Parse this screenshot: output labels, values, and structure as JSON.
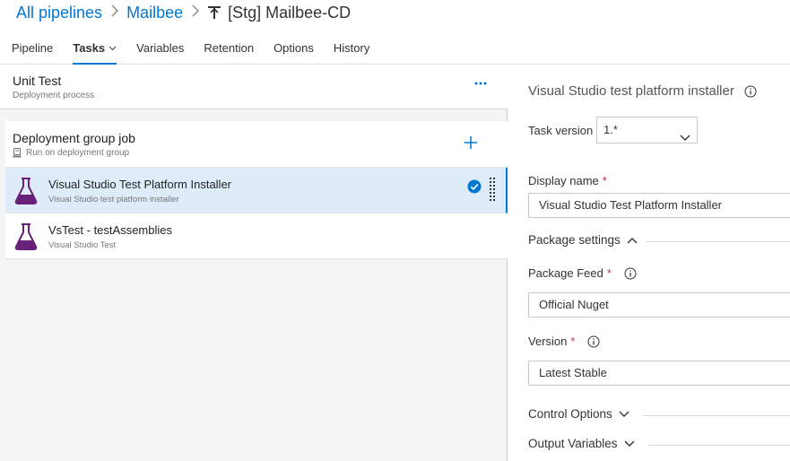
{
  "breadcrumb": {
    "all_pipelines": "All pipelines",
    "folder": "Mailbee",
    "pipeline_name": "[Stg] Mailbee-CD",
    "pipeline_icon": "release-pipeline-icon"
  },
  "tabs": [
    {
      "label": "Pipeline"
    },
    {
      "label": "Tasks",
      "active": true
    },
    {
      "label": "Variables"
    },
    {
      "label": "Retention"
    },
    {
      "label": "Options"
    },
    {
      "label": "History"
    }
  ],
  "stage": {
    "title": "Unit Test",
    "subtitle": "Deployment process"
  },
  "phase": {
    "title": "Deployment group job",
    "subtitle": "Run on deployment group"
  },
  "tasks": [
    {
      "title": "Visual Studio Test Platform Installer",
      "subtitle": "Visual Studio test platform installer",
      "selected": true
    },
    {
      "title": "VsTest - testAssemblies",
      "subtitle": "Visual Studio Test",
      "selected": false
    }
  ],
  "details": {
    "title": "Visual Studio test platform installer",
    "task_version_label": "Task version",
    "task_version_value": "1.*",
    "display_name_label": "Display name",
    "display_name_value": "Visual Studio Test Platform Installer",
    "package_settings_label": "Package settings",
    "package_feed_label": "Package Feed",
    "package_feed_value": "Official Nuget",
    "version_label": "Version",
    "version_value": "Latest Stable",
    "control_options_label": "Control Options",
    "output_variables_label": "Output Variables",
    "required_mark": "*"
  },
  "colors": {
    "accent": "#0078d4",
    "selected_row": "#deecf9",
    "flask": "#68217a",
    "required": "#c4314b"
  }
}
